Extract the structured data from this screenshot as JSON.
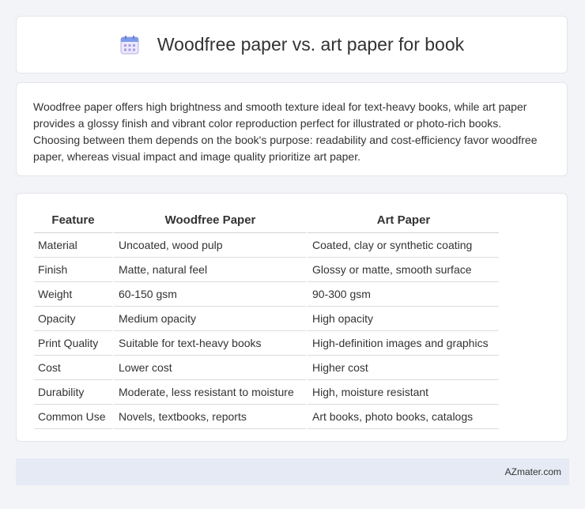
{
  "header": {
    "title": "Woodfree paper vs. art paper for book",
    "icon": "calendar-icon"
  },
  "intro": {
    "text": "Woodfree paper offers high brightness and smooth texture ideal for text-heavy books, while art paper provides a glossy finish and vibrant color reproduction perfect for illustrated or photo-rich books. Choosing between them depends on the book's purpose: readability and cost-efficiency favor woodfree paper, whereas visual impact and image quality prioritize art paper."
  },
  "table": {
    "headers": [
      "Feature",
      "Woodfree Paper",
      "Art Paper"
    ],
    "rows": [
      [
        "Material",
        "Uncoated, wood pulp",
        "Coated, clay or synthetic coating"
      ],
      [
        "Finish",
        "Matte, natural feel",
        "Glossy or matte, smooth surface"
      ],
      [
        "Weight",
        "60-150 gsm",
        "90-300 gsm"
      ],
      [
        "Opacity",
        "Medium opacity",
        "High opacity"
      ],
      [
        "Print Quality",
        "Suitable for text-heavy books",
        "High-definition images and graphics"
      ],
      [
        "Cost",
        "Lower cost",
        "Higher cost"
      ],
      [
        "Durability",
        "Moderate, less resistant to moisture",
        "High, moisture resistant"
      ],
      [
        "Common Use",
        "Novels, textbooks, reports",
        "Art books, photo books, catalogs"
      ]
    ]
  },
  "footer": {
    "brand": "AZmater.com"
  }
}
